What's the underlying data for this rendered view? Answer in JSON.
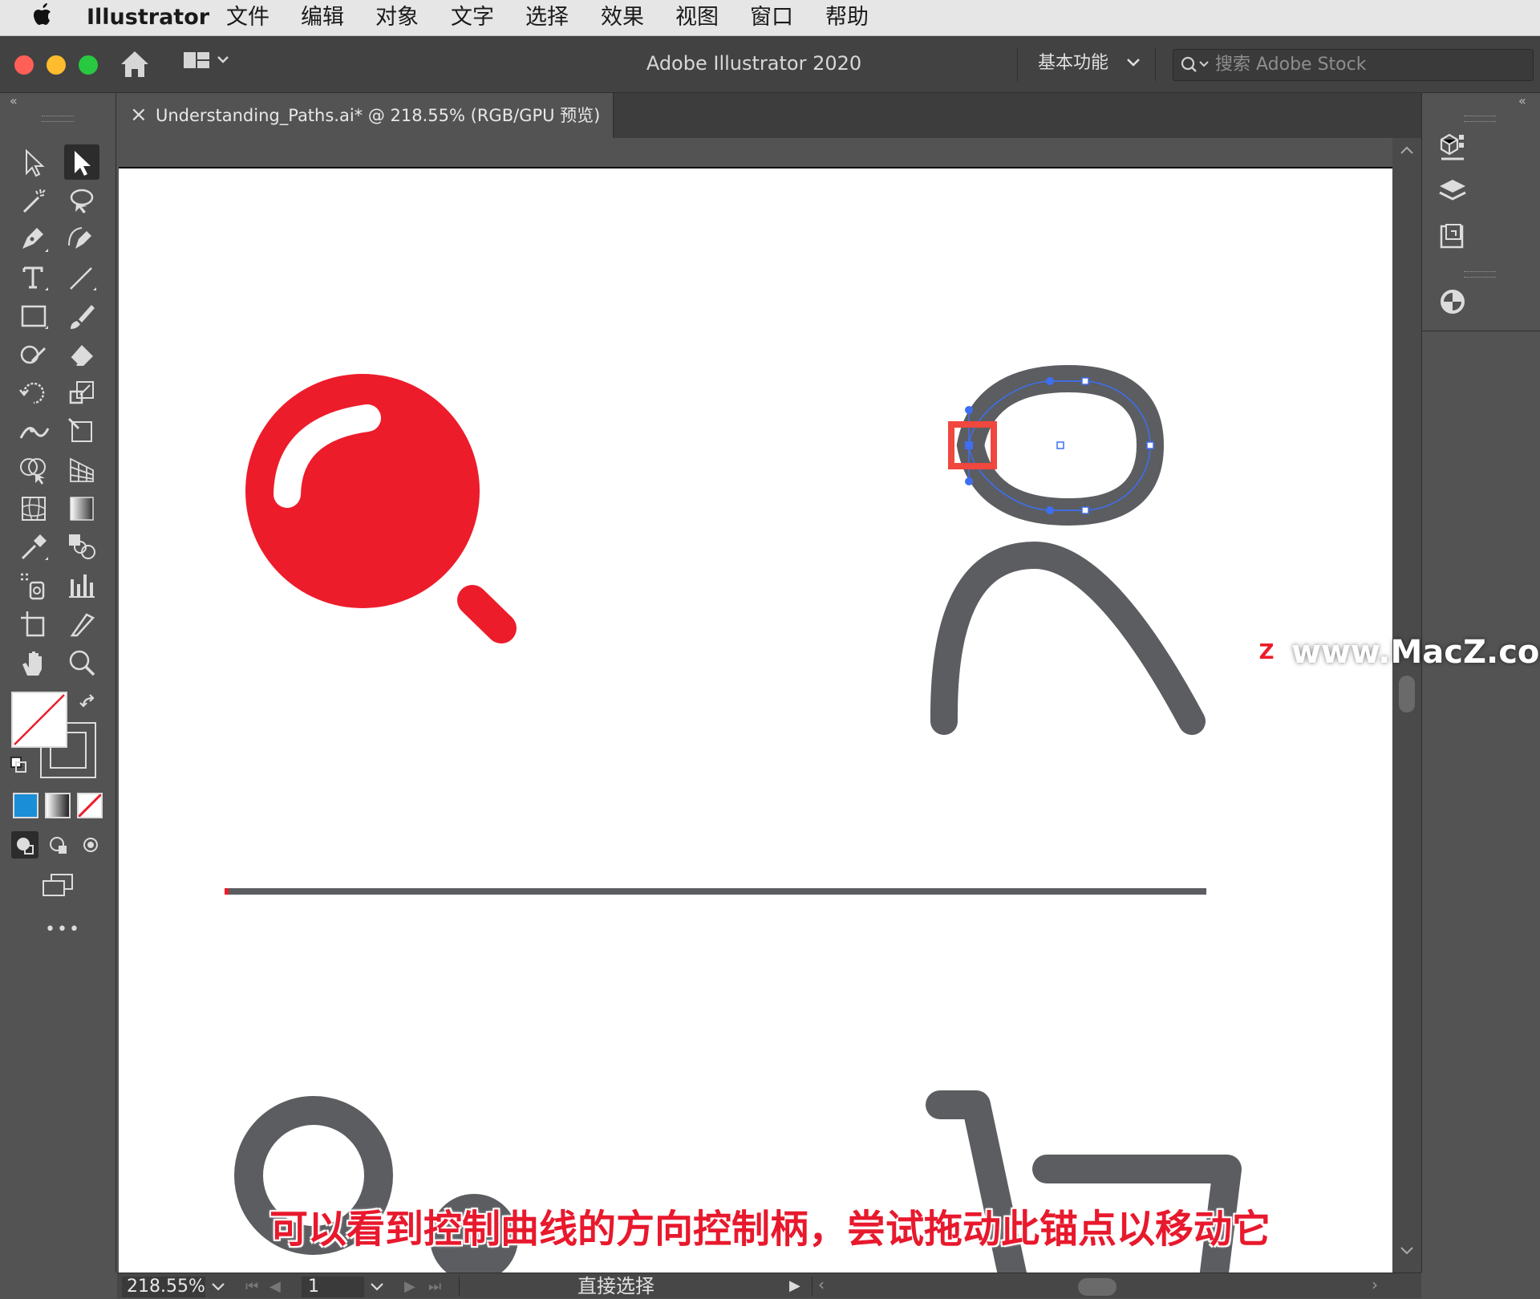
{
  "menubar": {
    "app": "Illustrator",
    "items": [
      "文件",
      "编辑",
      "对象",
      "文字",
      "选择",
      "效果",
      "视图",
      "窗口",
      "帮助"
    ]
  },
  "titlebar": {
    "title": "Adobe Illustrator 2020",
    "workspace": "基本功能",
    "search_placeholder": "搜索 Adobe Stock"
  },
  "document_tab": {
    "close": "×",
    "label": "Understanding_Paths.ai* @ 218.55% (RGB/GPU 预览)"
  },
  "panel_collapse": {
    "left": "«",
    "right": "«"
  },
  "statusbar": {
    "zoom": "218.55%",
    "artboard": "1",
    "tool_name": "直接选择"
  },
  "toolbar": {
    "active_tool": "direct-selection",
    "more": "•••"
  },
  "caption": "可以看到控制曲线的方向控制柄，尝试拖动此锚点以移动它",
  "watermark": "www.MacZ.com",
  "colors": {
    "accent_red": "#ed1c2b",
    "path_gray": "#5b5d60",
    "selection_blue": "#3e6ff3",
    "highlight_box": "#f0473e"
  }
}
